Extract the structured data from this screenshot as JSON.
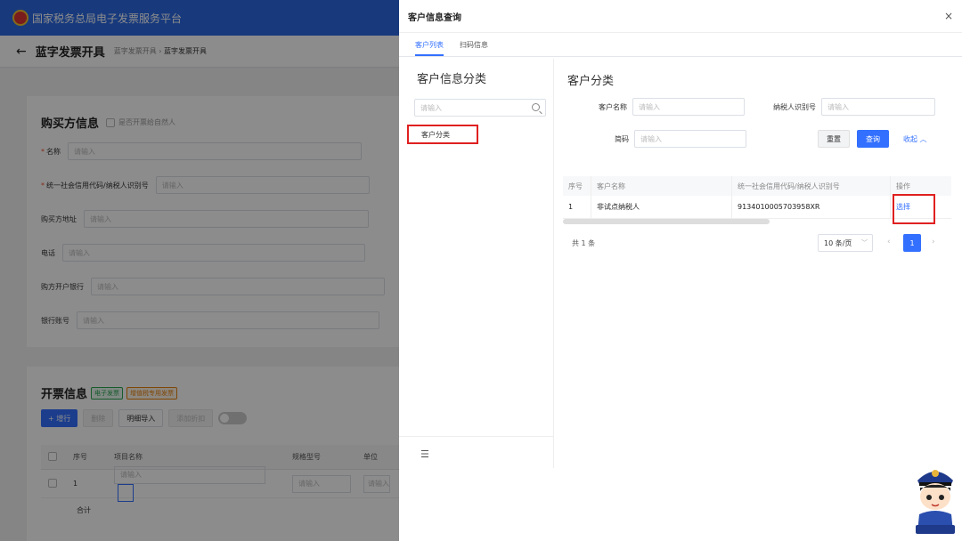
{
  "background": {
    "platform_title": "国家税务总局电子发票服务平台",
    "page_title": "蓝字发票开具",
    "breadcrumb": {
      "parent": "蓝字发票开具",
      "current": "蓝字发票开具"
    },
    "buyer_section": {
      "title": "购买方信息",
      "natural_person_label": "是否开票给自然人",
      "fields": [
        {
          "label": "名称",
          "required": true,
          "placeholder": "请输入"
        },
        {
          "label": "统一社会信用代码/纳税人识别号",
          "required": true,
          "placeholder": "请输入"
        },
        {
          "label": "购买方地址",
          "required": false,
          "placeholder": "请输入"
        },
        {
          "label": "电话",
          "required": false,
          "placeholder": "请输入"
        },
        {
          "label": "购方开户银行",
          "required": false,
          "placeholder": "请输入"
        },
        {
          "label": "银行账号",
          "required": false,
          "placeholder": "请输入"
        }
      ]
    },
    "invoice_section": {
      "title": "开票信息",
      "tag_electronic": "电子发票",
      "tag_special": "增值税专用发票",
      "add_row": "+ 增行",
      "delete": "删除",
      "detail_import": "明细导入",
      "add_discount": "添加折扣",
      "columns": [
        "序号",
        "项目名称",
        "规格型号",
        "单位"
      ],
      "row_no": "1",
      "placeholder": "请输入",
      "total_label": "合计"
    }
  },
  "drawer": {
    "title": "客户信息查询",
    "close": "×",
    "tabs": [
      {
        "label": "客户列表",
        "active": true
      },
      {
        "label": "扫码信息",
        "active": false
      }
    ],
    "left": {
      "title": "客户信息分类",
      "search_placeholder": "请输入",
      "category_item": "客户分类",
      "menu_icon": "☰"
    },
    "right": {
      "title": "客户分类",
      "fields": {
        "customer_name": {
          "label": "客户名称",
          "placeholder": "请输入"
        },
        "taxpayer_id": {
          "label": "纳税人识别号",
          "placeholder": "请输入"
        },
        "short_code": {
          "label": "简码",
          "placeholder": "请输入"
        }
      },
      "reset": "重置",
      "query": "查询",
      "collapse": "收起 ︿",
      "table": {
        "headers": [
          "序号",
          "客户名称",
          "统一社会信用代码/纳税人识别号",
          "操作"
        ],
        "rows": [
          {
            "no": "1",
            "name": "非试点纳税人",
            "code": "9134010005703958XR",
            "action": "选择"
          }
        ]
      },
      "pager": {
        "total": "共 1 条",
        "page_size": "10 条/页",
        "prev": "‹",
        "current": "1",
        "next": "›"
      }
    }
  },
  "colors": {
    "primary": "#3370ff",
    "highlight": "#e02020",
    "topbar": "#2d6ae3"
  }
}
